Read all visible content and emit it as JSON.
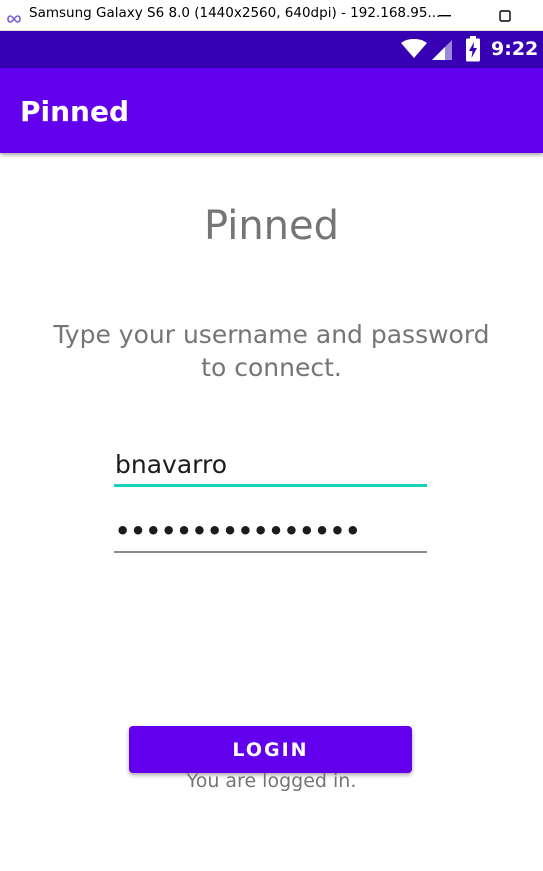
{
  "window": {
    "title": "Samsung Galaxy S6 8.0 (1440x2560, 640dpi) - 192.168.95...",
    "icon": "infinity-icon",
    "controls": [
      "minimize-icon",
      "maximize-icon"
    ]
  },
  "status_bar": {
    "time": "9:22",
    "icons": [
      "wifi-icon",
      "signal-icon",
      "battery-charging-icon"
    ],
    "color": "#3700b3"
  },
  "app_bar": {
    "title": "Pinned",
    "color": "#6200ee"
  },
  "login_form": {
    "heading": "Pinned",
    "instructions": "Type your username and password to connect.",
    "username_value": "bnavarro",
    "password_value": "••••••••••••••••",
    "login_label": "LOGIN",
    "status_message": "You are logged in.",
    "accent_color": "#18d1bc"
  }
}
